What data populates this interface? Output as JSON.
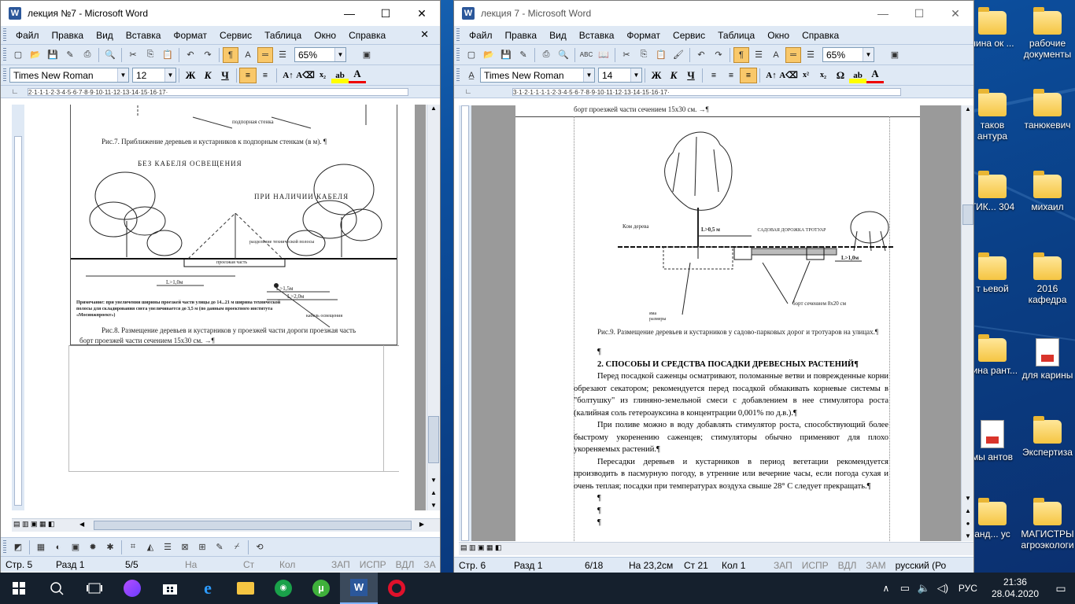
{
  "desktop": {
    "icons": [
      {
        "label": "нина ок ...",
        "kind": "folder"
      },
      {
        "label": "рабочие документы",
        "kind": "folder"
      },
      {
        "label": "таков антура",
        "kind": "folder"
      },
      {
        "label": "танюкевич",
        "kind": "folder"
      },
      {
        "label": "ТИК... 304",
        "kind": "folder"
      },
      {
        "label": "михаил",
        "kind": "folder"
      },
      {
        "label": "т ьевой",
        "kind": "folder"
      },
      {
        "label": "2016 кафедра",
        "kind": "folder"
      },
      {
        "label": "нина рант...",
        "kind": "folder"
      },
      {
        "label": "для карины",
        "kind": "pdf"
      },
      {
        "label": "мы антов",
        "kind": "doc"
      },
      {
        "label": "Экспертиза",
        "kind": "folder"
      },
      {
        "label": "анд... ус",
        "kind": "folder"
      },
      {
        "label": "МАГИСТРЫ агроэкологи",
        "kind": "folder"
      }
    ]
  },
  "left_window": {
    "title": "лекция №7 - Microsoft Word",
    "menu": [
      "Файл",
      "Правка",
      "Вид",
      "Вставка",
      "Формат",
      "Сервис",
      "Таблица",
      "Окно",
      "Справка"
    ],
    "zoom": "65%",
    "font_name": "Times New Roman",
    "font_size": "12",
    "fig7_caption": "Рис.7. Приближение деревьев и кустарников к подпорным стенкам (в м). ¶",
    "fig7_label_top": "подпорная стенка",
    "fig8_label_nocable": "БЕЗ КАБЕЛЯ ОСВЕЩЕНИЯ",
    "fig8_label_cable": "ПРИ НАЛИЧИИ КАБЕЛЯ",
    "fig8_label_road": "проезжая часть",
    "fig8_label_strip": "разделение технической полосы",
    "fig8_label_cable_light": "кабель освещения",
    "fig8_dim1": "L>1,0м",
    "fig8_dim2": "L>1,5м",
    "fig8_dim3": "L>2,0м",
    "fig8_note": "Примечание: при увеличении ширины проезжей части улицы до 14...21 м ширина технической полосы для складирования снега увеличивается до 3,5 м (по данным проектного института «Мосинжпроект»)",
    "fig8_caption": "Рис.8. Размещение деревьев и кустарников у проезжей части дороги проезжая часть",
    "fig8_caption2": "борт проезжей части сечением 15x30 см. →¶",
    "status": {
      "page": "Стр. 5",
      "section": "Разд 1",
      "pages": "5/5",
      "at": "На",
      "line": "Ст",
      "col": "Кол",
      "rec": "ЗАП",
      "trk": "ИСПР",
      "ext": "ВДЛ",
      "ovr": "ЗА"
    },
    "ruler_text": "2·1·1·1·2·3·4·5·6·7·8·9·10·11·12·13·14·15·16·17·"
  },
  "right_window": {
    "title": "лекция 7 - Microsoft Word",
    "menu": [
      "Файл",
      "Правка",
      "Вид",
      "Вставка",
      "Формат",
      "Сервис",
      "Таблица",
      "Окно",
      "Справка"
    ],
    "zoom": "65%",
    "font_name": "Times New Roman",
    "font_size": "14",
    "top_caption": "борт проезжей части сечением 15х30 см. →¶",
    "fig9_labels": {
      "kom": "Ком дерева",
      "l05": "L>0,5 м",
      "path": "САДОВАЯ ДОРОЖКА ТРОТУАР",
      "l10": "L>1,0м",
      "bort": "борт сечением 8х20 см",
      "pit": "яма размеры"
    },
    "fig9_caption": "Рис.9. Размещение деревьев и кустарников у садово-парковых дорог и тротуаров на улицах.¶",
    "pilcrow": "¶",
    "heading": "2. СПОСОБЫ И СРЕДСТВА ПОСАДКИ ДРЕВЕСНЫХ РАСТЕНИЙ¶",
    "p1": "Перед посадкой саженцы осматривают, поломанные ветви и поврежденные корни обрезают секатором; рекомендуется перед посадкой обмакивать корневые системы в \"болтушку\" из глиняно-земельной смеси с добавлением в нее стимулятора роста (калийная соль гетероауксина в концентрации 0,001% по д.в.).¶",
    "p2": "При поливе можно в воду добавлять стимулятор роста, способствующий более быстрому укоренению саженцев; стимуляторы обычно применяют для плохо укореняемых растений.¶",
    "p3": "Пересадки деревьев и кустарников в период вегетации рекомендуется производить в пасмурную погоду, в утренние или вечерние часы, если погода сухая и очень теплая; посадки при температурах воздуха свыше 28° С следует прекращать.¶",
    "status": {
      "page": "Стр. 6",
      "section": "Разд 1",
      "pages": "6/18",
      "at": "На 23,2см",
      "line": "Ст 21",
      "col": "Кол 1",
      "rec": "ЗАП",
      "trk": "ИСПР",
      "ext": "ВДЛ",
      "ovr": "ЗАМ",
      "lang": "русский (Ро"
    },
    "ruler_text": "3·1·2·1·1·1·1·2·3·4·5·6·7·8·9·10·11·12·13·14·15·16·17·"
  },
  "taskbar": {
    "lang": "РУС",
    "time": "21:36",
    "date": "28.04.2020"
  }
}
